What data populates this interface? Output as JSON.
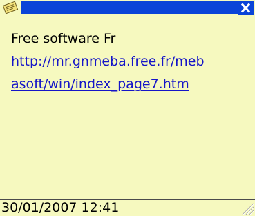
{
  "note": {
    "title": "",
    "lines": [
      "Free software Fr"
    ],
    "link_lines": [
      "http://mr.gnmeba.free.fr/meb",
      "asoft/win/index_page7.htm"
    ],
    "timestamp": "30/01/2007 12:41"
  },
  "icons": {
    "note": "note-icon",
    "close": "close-icon",
    "resize": "resize-grip-icon"
  },
  "colors": {
    "background": "#f6f9bf",
    "titlebar": "#0a44d8",
    "link": "#1515c8",
    "text": "#000000"
  }
}
